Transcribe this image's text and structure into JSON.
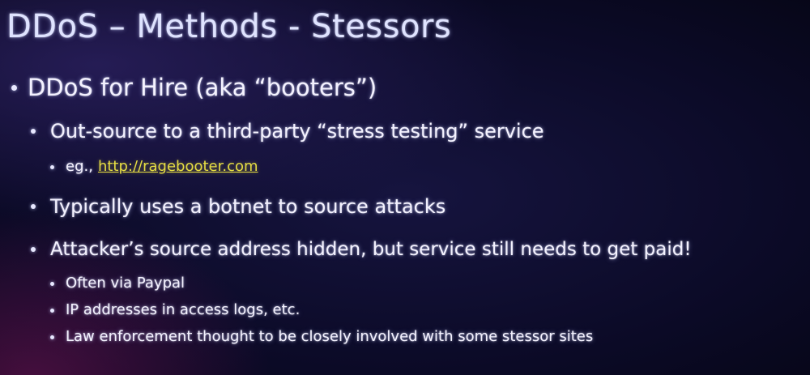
{
  "slide": {
    "title": "DDoS – Methods - Stessors",
    "bullets": {
      "b1": "DDoS for Hire (aka “booters”)",
      "b1_1": "Out-source to a third-party “stress testing” service",
      "b1_1_1_prefix": "eg.,",
      "b1_1_1_link": "http://ragebooter.com",
      "b1_2": "Typically uses a botnet to source attacks",
      "b1_3": "Attacker’s source address hidden, but service still needs to get paid!",
      "b1_3_1": "Often via Paypal",
      "b1_3_2": "IP addresses in access logs, etc.",
      "b1_3_3": "Law enforcement thought to be closely involved with some stessor sites"
    },
    "colors": {
      "text": "#f4f2ff",
      "title": "#dfe3ff",
      "link": "#e6dd43",
      "background": "#0b0a26"
    }
  }
}
